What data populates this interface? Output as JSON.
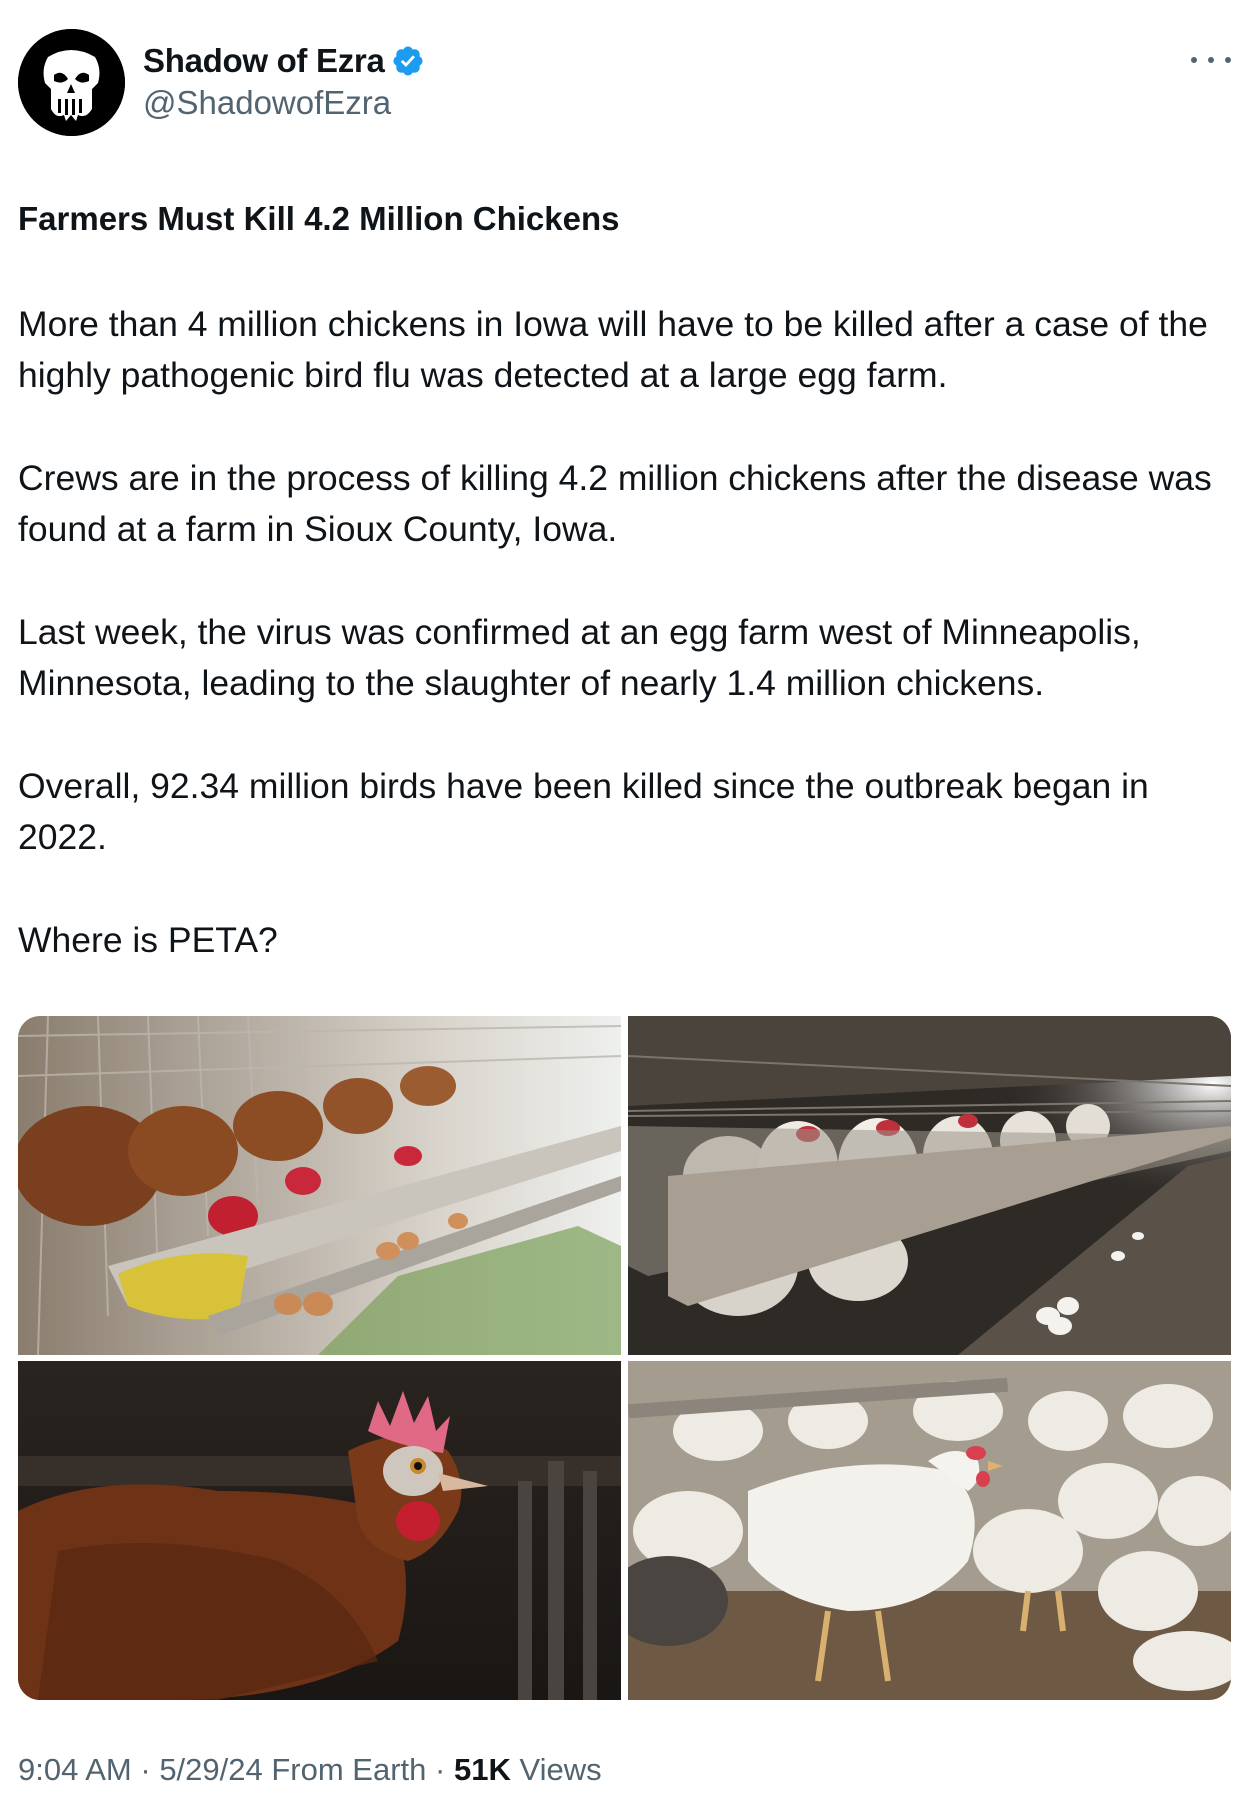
{
  "author": {
    "display_name": "Shadow of Ezra",
    "handle": "@ShadowofEzra",
    "verified": true,
    "avatar_icon": "punisher-skull-icon"
  },
  "post": {
    "headline": "Farmers Must Kill 4.2 Million Chickens",
    "paragraphs": [
      "More than 4 million chickens in Iowa will have to be killed after a case of the highly pathogenic bird flu was detected at a large egg farm.",
      "Crews are in the process of killing 4.2 million chickens after the disease was found at a farm in Sioux County, Iowa.",
      "Last week, the virus was confirmed at an egg farm west of Minneapolis, Minnesota, leading to the slaughter of nearly 1.4 million chickens.",
      "Overall, 92.34 million birds have been killed since the outbreak began in 2022.",
      "Where is PETA?"
    ]
  },
  "media": {
    "photos": [
      {
        "name": "brown-hens-in-cages-photo"
      },
      {
        "name": "white-hens-in-cage-rows-photo"
      },
      {
        "name": "brown-hen-closeup-photo"
      },
      {
        "name": "white-chickens-on-floor-photo"
      }
    ]
  },
  "meta": {
    "time": "9:04 AM",
    "sep1": " · ",
    "date": "5/29/24",
    "source": " From Earth",
    "sep2": " · ",
    "views_count": "51K",
    "views_label": " Views"
  },
  "colors": {
    "text": "#0f1419",
    "secondary": "#536471",
    "verified": "#1d9bf0"
  }
}
